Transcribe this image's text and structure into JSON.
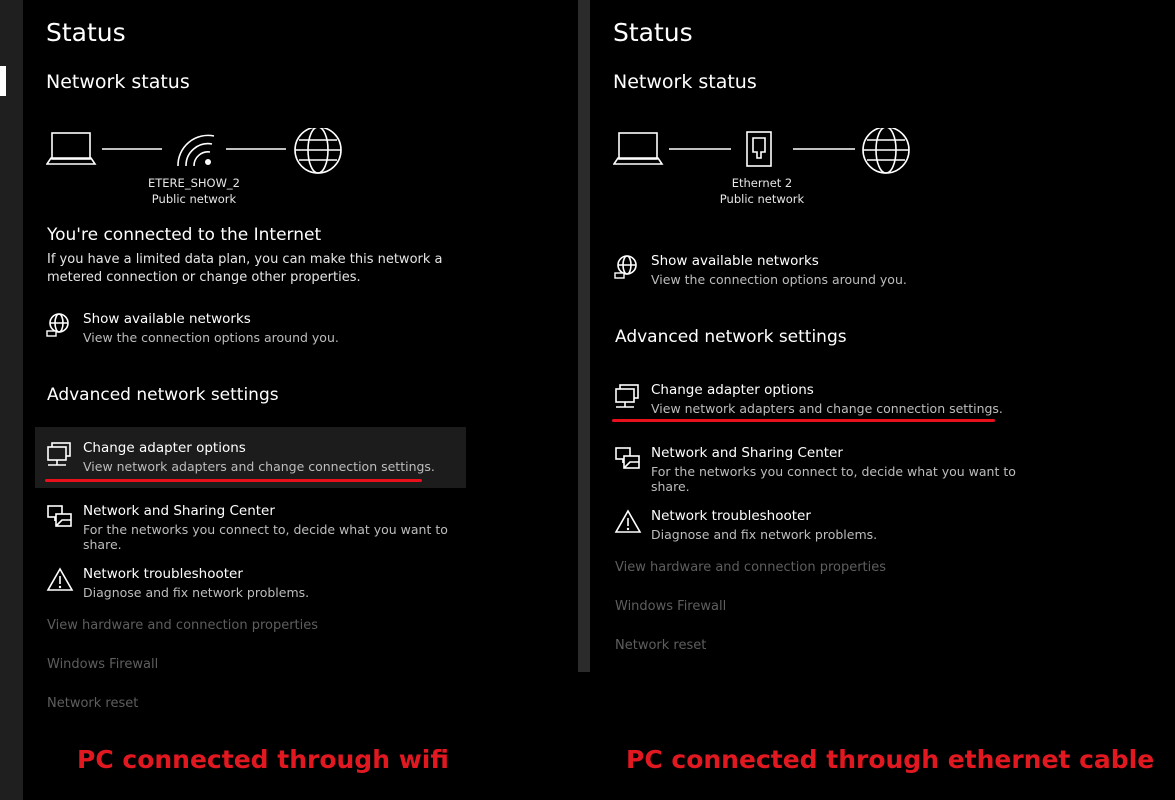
{
  "left": {
    "page_title": "Status",
    "section_status": "Network status",
    "network_name": "ETERE_SHOW_2",
    "network_type": "Public network",
    "connected_heading": "You're connected to the Internet",
    "connected_desc_1": "If you have a limited data plan, you can make this network a",
    "connected_desc_2": "metered connection or change other properties.",
    "show_networks_title": "Show available networks",
    "show_networks_desc": "View the connection options around you.",
    "advanced_heading": "Advanced network settings",
    "adapter_title": "Change adapter options",
    "adapter_desc": "View network adapters and change connection settings.",
    "sharing_title": "Network and Sharing Center",
    "sharing_desc": "For the networks you connect to, decide what you want to share.",
    "troubleshoot_title": "Network troubleshooter",
    "troubleshoot_desc": "Diagnose and fix network problems.",
    "link_hardware": "View hardware and connection properties",
    "link_firewall": "Windows Firewall",
    "link_reset": "Network reset",
    "caption": "PC connected through wifi"
  },
  "right": {
    "page_title": "Status",
    "section_status": "Network status",
    "network_name": "Ethernet 2",
    "network_type": "Public network",
    "show_networks_title": "Show available networks",
    "show_networks_desc": "View the connection options around you.",
    "advanced_heading": "Advanced network settings",
    "adapter_title": "Change adapter options",
    "adapter_desc": "View network adapters and change connection settings.",
    "sharing_title": "Network and Sharing Center",
    "sharing_desc": "For the networks you connect to, decide what you want to share.",
    "troubleshoot_title": "Network troubleshooter",
    "troubleshoot_desc": "Diagnose and fix network problems.",
    "link_hardware": "View hardware and connection properties",
    "link_firewall": "Windows Firewall",
    "link_reset": "Network reset",
    "caption": "PC connected through ethernet cable"
  },
  "icons": {
    "laptop": "laptop-icon",
    "wifi": "wifi-icon",
    "ethernet": "ethernet-icon",
    "globe": "globe-icon",
    "show_networks": "globe-network-icon",
    "adapter": "adapter-monitor-icon",
    "sharing": "sharing-center-icon",
    "troubleshoot": "warning-triangle-icon"
  },
  "colors": {
    "background": "#000000",
    "highlight": "#1c1c1c",
    "annotation_red": "#e21820",
    "disabled_link": "#5e5e5e"
  }
}
